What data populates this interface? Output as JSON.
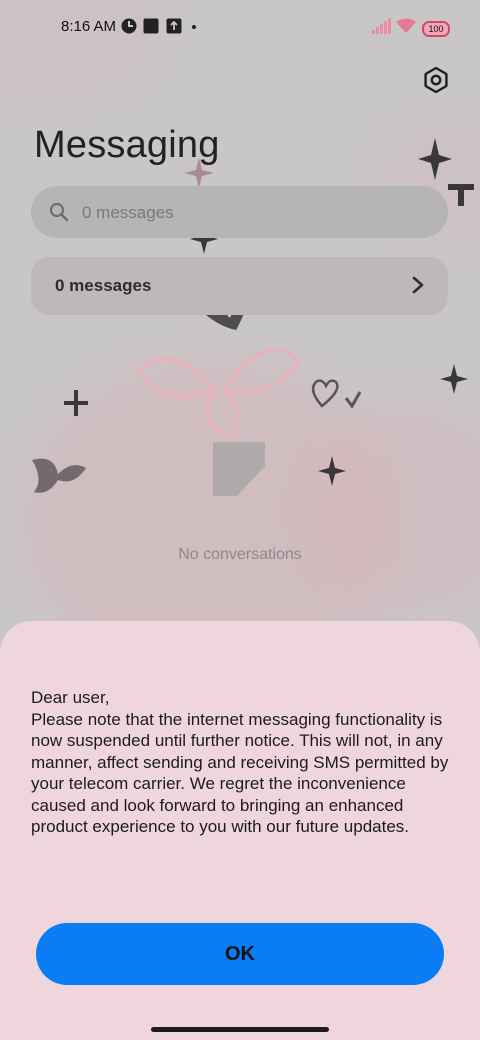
{
  "status_bar": {
    "time": "8:16 AM",
    "battery": "100",
    "icons": [
      "app-icon",
      "square-icon",
      "upload-icon",
      "dot-icon",
      "signal-icon",
      "wifi-icon",
      "battery-icon"
    ]
  },
  "header": {
    "title": "Messaging",
    "settings_icon": "settings-hex-icon"
  },
  "search": {
    "placeholder": "0 messages"
  },
  "summary_row": {
    "label": "0 messages"
  },
  "empty_state": {
    "text": "No conversations"
  },
  "dialog": {
    "greeting": "Dear user,",
    "body": "Please note that the internet messaging functionality is now suspended until further notice. This will not, in any manner, affect sending and receiving SMS permitted by your telecom carrier. We regret the inconvenience caused and look forward to bringing an enhanced product experience to you with our future updates.",
    "ok_label": "OK"
  },
  "colors": {
    "accent": "#0a7cf5",
    "sheet": "#efd6dd",
    "battery": "#d04a66"
  }
}
